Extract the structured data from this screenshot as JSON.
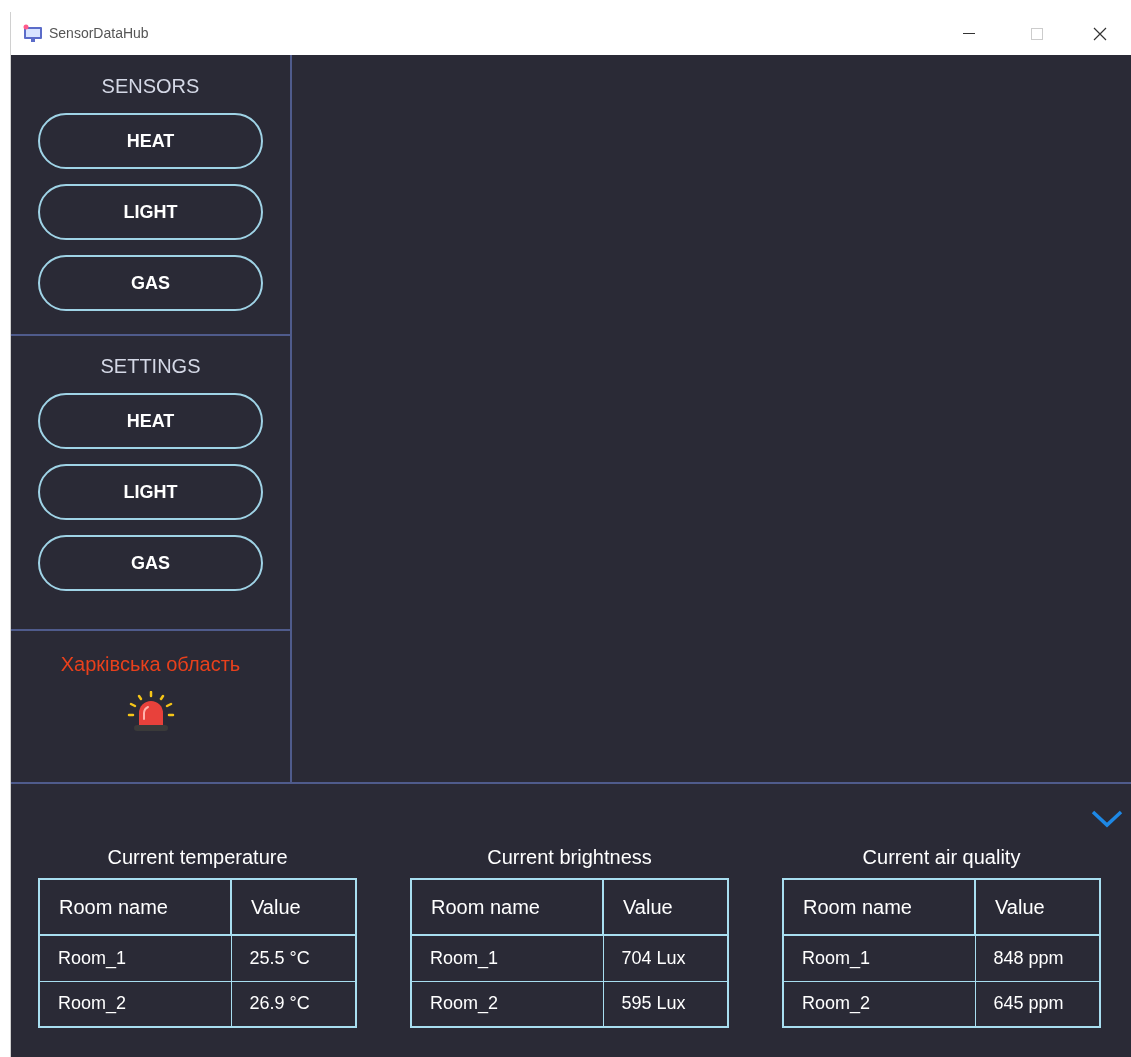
{
  "window": {
    "title": "SensorDataHub"
  },
  "sidebar": {
    "sections": [
      {
        "title": "SENSORS",
        "buttons": [
          "HEAT",
          "LIGHT",
          "GAS"
        ]
      },
      {
        "title": "SETTINGS",
        "buttons": [
          "HEAT",
          "LIGHT",
          "GAS"
        ]
      }
    ],
    "alert": {
      "region": "Харківська область",
      "active": true
    }
  },
  "tables": [
    {
      "title": "Current temperature",
      "columns": [
        "Room name",
        "Value"
      ],
      "rows": [
        [
          "Room_1",
          "25.5 °C"
        ],
        [
          "Room_2",
          "26.9 °C"
        ]
      ]
    },
    {
      "title": "Current brightness",
      "columns": [
        "Room name",
        "Value"
      ],
      "rows": [
        [
          "Room_1",
          "704 Lux"
        ],
        [
          "Room_2",
          "595 Lux"
        ]
      ]
    },
    {
      "title": "Current air quality",
      "columns": [
        "Room name",
        "Value"
      ],
      "rows": [
        [
          "Room_1",
          "848 ppm"
        ],
        [
          "Room_2",
          "645 ppm"
        ]
      ]
    }
  ]
}
